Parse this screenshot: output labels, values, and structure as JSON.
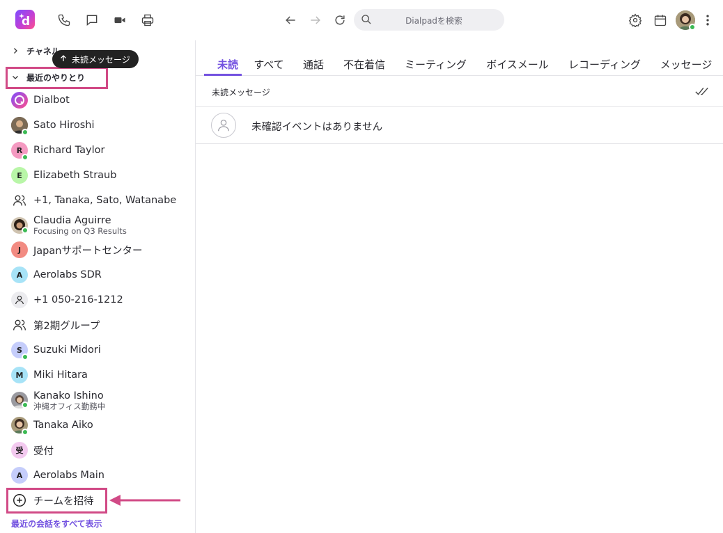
{
  "topbar": {
    "search_placeholder": "Dialpadを検索"
  },
  "sidebar": {
    "channels_label": "チャネル",
    "recent_label": "最近のやりとり",
    "tooltip_label": "未読メッセージ",
    "items": [
      {
        "name": "Dialbot",
        "avatar": "dialbot"
      },
      {
        "name": "Sato Hiroshi",
        "avatar": "photo"
      },
      {
        "name": "Richard Taylor",
        "initial": "R",
        "color": "#f49ac1"
      },
      {
        "name": "Elizabeth Straub",
        "initial": "E",
        "color": "#b9f6a8"
      },
      {
        "name": "+1, Tanaka, Sato, Watanabe",
        "avatar": "group"
      },
      {
        "name": "Claudia Aguirre",
        "sub": "Focusing on Q3 Results",
        "avatar": "photo"
      },
      {
        "name": "Japanサポートセンター",
        "initial": "J",
        "color": "#f28b82"
      },
      {
        "name": "Aerolabs SDR",
        "initial": "A",
        "color": "#a7e3f7"
      },
      {
        "name": "+1 050-216-1212",
        "avatar": "person"
      },
      {
        "name": "第2期グループ",
        "avatar": "group"
      },
      {
        "name": "Suzuki Midori",
        "initial": "S",
        "color": "#c5cdfb"
      },
      {
        "name": "Miki Hitara",
        "initial": "M",
        "color": "#a7e3f7"
      },
      {
        "name": "Kanako Ishino",
        "sub": "沖縄オフィス勤務中",
        "avatar": "photo"
      },
      {
        "name": "Tanaka Aiko",
        "avatar": "photo"
      },
      {
        "name": "受付",
        "initial": "受",
        "color": "#f3c9ef"
      },
      {
        "name": "Aerolabs Main",
        "initial": "A",
        "color": "#c5cdfb"
      }
    ],
    "invite_label": "チームを招待",
    "show_all_label": "最近の会話をすべて表示"
  },
  "tabs": [
    "未読",
    "すべて",
    "通話",
    "不在着信",
    "ミーティング",
    "ボイスメール",
    "レコーディング",
    "メッセージ"
  ],
  "main": {
    "section_title": "未読メッセージ",
    "empty_message": "未確認イベントはありません"
  },
  "colors": {
    "accent": "#7352e0",
    "highlight": "#d14a86",
    "online": "#3cba54"
  }
}
